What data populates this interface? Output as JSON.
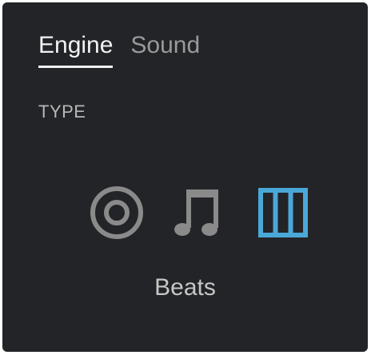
{
  "tabs": [
    {
      "label": "Engine",
      "active": true
    },
    {
      "label": "Sound",
      "active": false
    }
  ],
  "section": {
    "label": "TYPE"
  },
  "type_options": [
    {
      "icon": "disc-icon",
      "selected": false
    },
    {
      "icon": "music-note-icon",
      "selected": false
    },
    {
      "icon": "beats-grid-icon",
      "selected": true
    }
  ],
  "selected_type_label": "Beats",
  "colors": {
    "background": "#232427",
    "active_text": "#f2f2f2",
    "inactive_text": "#9a9a9a",
    "icon_gray": "#8a8a8a",
    "accent_blue": "#4aa8d8"
  }
}
